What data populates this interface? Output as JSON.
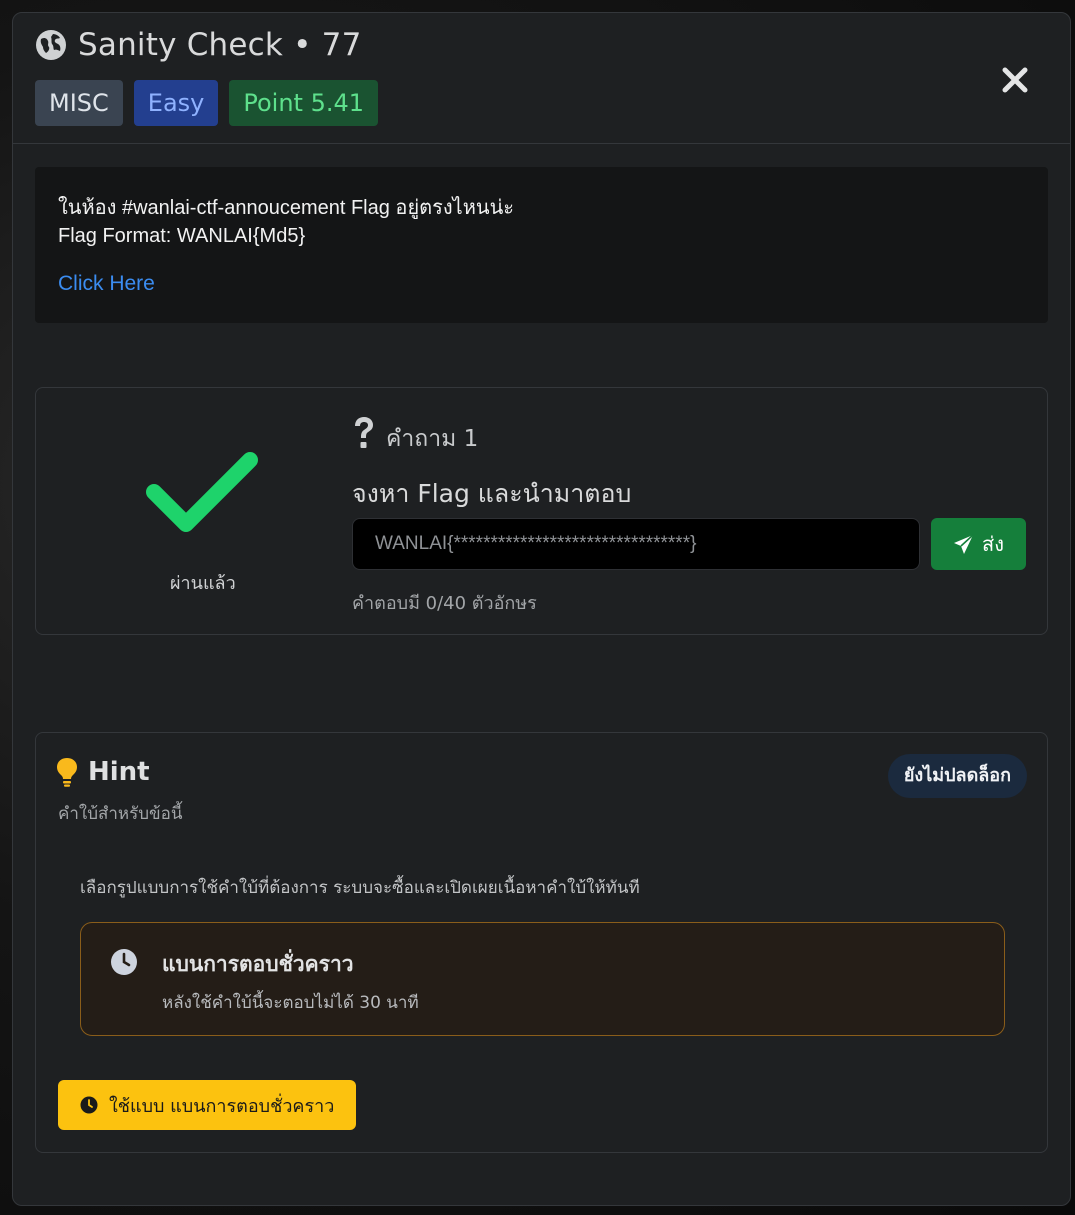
{
  "header": {
    "title": "Sanity Check • 77",
    "icon": "globe-icon",
    "badges": {
      "category": "MISC",
      "difficulty": "Easy",
      "points": "Point 5.41"
    },
    "close_icon": "close-icon"
  },
  "description": {
    "line1": "ในห้อง #wanlai-ctf-annoucement Flag อยู่ตรงไหนน่ะ",
    "line2": "Flag Format: WANLAI{Md5}",
    "link_text": "Click Here"
  },
  "question": {
    "status_icon": "check-icon",
    "status_label": "ผ่านแล้ว",
    "label": "คำถาม 1",
    "text": "จงหา Flag และนำมาตอบ",
    "answer_value": "WANLAI{********************************}",
    "submit_label": "ส่ง",
    "char_count": "คำตอบมี  0/40  ตัวอักษร"
  },
  "hint": {
    "title": "Hint",
    "subtitle": "คำใบ้สำหรับข้อนี้",
    "status": "ยังไม่ปลดล็อก",
    "instruction": "เลือกรูปแบบการใช้คำใบ้ที่ต้องการ ระบบจะซื้อและเปิดเผยเนื้อหาคำใบ้ให้ทันที",
    "option": {
      "title": "แบนการตอบชั่วคราว",
      "description": "หลังใช้คำใบ้นี้จะตอบไม่ได้ 30 นาที"
    },
    "use_button_label": "ใช้แบบ แบนการตอบชั่วคราว"
  },
  "colors": {
    "accent_green": "#157f3b",
    "check_green": "#1ed36b",
    "link_blue": "#3b8cf0",
    "warning_yellow": "#fcc20f"
  }
}
